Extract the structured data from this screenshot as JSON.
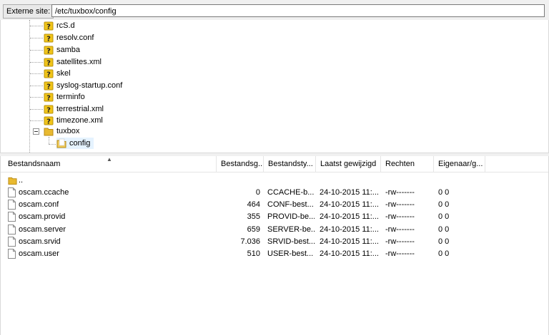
{
  "path_bar": {
    "label": "Externe site:",
    "value": "/etc/tuxbox/config"
  },
  "tree": {
    "items": [
      {
        "name": "rcS.d",
        "icon": "question-folder-icon"
      },
      {
        "name": "resolv.conf",
        "icon": "question-folder-icon"
      },
      {
        "name": "samba",
        "icon": "question-folder-icon"
      },
      {
        "name": "satellites.xml",
        "icon": "question-folder-icon"
      },
      {
        "name": "skel",
        "icon": "question-folder-icon"
      },
      {
        "name": "syslog-startup.conf",
        "icon": "question-folder-icon"
      },
      {
        "name": "terminfo",
        "icon": "question-folder-icon"
      },
      {
        "name": "terrestrial.xml",
        "icon": "question-folder-icon"
      },
      {
        "name": "timezone.xml",
        "icon": "question-folder-icon"
      },
      {
        "name": "tuxbox",
        "icon": "folder-icon"
      },
      {
        "name": "config",
        "icon": "open-folder-icon"
      }
    ]
  },
  "file_list": {
    "columns": [
      "Bestandsnaam",
      "Bestandsg...",
      "Bestandsty...",
      "Laatst gewijzigd",
      "Rechten",
      "Eigenaar/g..."
    ],
    "parent_label": "..",
    "rows": [
      {
        "name": "oscam.ccache",
        "size": "0",
        "type": "CCACHE-b...",
        "modified": "24-10-2015 11:...",
        "perms": "-rw-------",
        "owner": "0 0"
      },
      {
        "name": "oscam.conf",
        "size": "464",
        "type": "CONF-best...",
        "modified": "24-10-2015 11:...",
        "perms": "-rw-------",
        "owner": "0 0"
      },
      {
        "name": "oscam.provid",
        "size": "355",
        "type": "PROVID-be...",
        "modified": "24-10-2015 11:...",
        "perms": "-rw-------",
        "owner": "0 0"
      },
      {
        "name": "oscam.server",
        "size": "659",
        "type": "SERVER-be...",
        "modified": "24-10-2015 11:...",
        "perms": "-rw-------",
        "owner": "0 0"
      },
      {
        "name": "oscam.srvid",
        "size": "7.036",
        "type": "SRVID-best...",
        "modified": "24-10-2015 11:...",
        "perms": "-rw-------",
        "owner": "0 0"
      },
      {
        "name": "oscam.user",
        "size": "510",
        "type": "USER-best...",
        "modified": "24-10-2015 11:...",
        "perms": "-rw-------",
        "owner": "0 0"
      }
    ]
  },
  "colors": {
    "folder": "#e8b930",
    "selection": "#e5f3ff"
  }
}
